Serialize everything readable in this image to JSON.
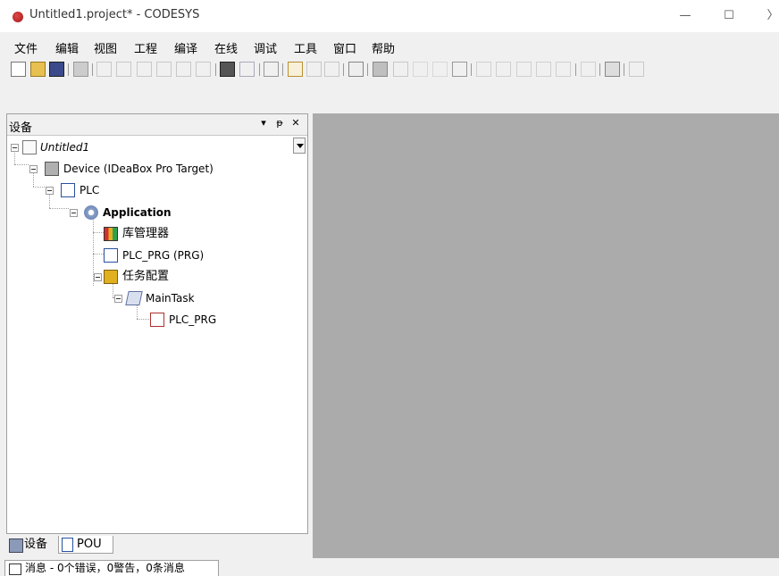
{
  "window": {
    "title": "Untitled1.project* - CODESYS",
    "minimize": "—",
    "maximize": "☐",
    "close": "〉"
  },
  "menu": [
    "文件",
    "编辑",
    "视图",
    "工程",
    "编译",
    "在线",
    "调试",
    "工具",
    "窗口",
    "帮助"
  ],
  "devices_panel": {
    "title": "设备",
    "dropdown_glyph": "▾",
    "pin_glyph": "ᵽ",
    "close_glyph": "✕",
    "tree": {
      "project": "Untitled1",
      "device": "Device (IDeaBox Pro Target)",
      "plc": "PLC",
      "application": "Application",
      "library_manager": "库管理器",
      "plc_prg": "PLC_PRG (PRG)",
      "task_config": "任务配置",
      "main_task": "MainTask",
      "task_plc_prg": "PLC_PRG"
    }
  },
  "bottom_tabs": {
    "devices": "设备",
    "pou": "POU"
  },
  "status": {
    "messages": "消息 - 0个错误，0警告，0条消息"
  },
  "colors": {
    "editor_bg": "#ababab",
    "chrome_bg": "#f0f0f0"
  }
}
